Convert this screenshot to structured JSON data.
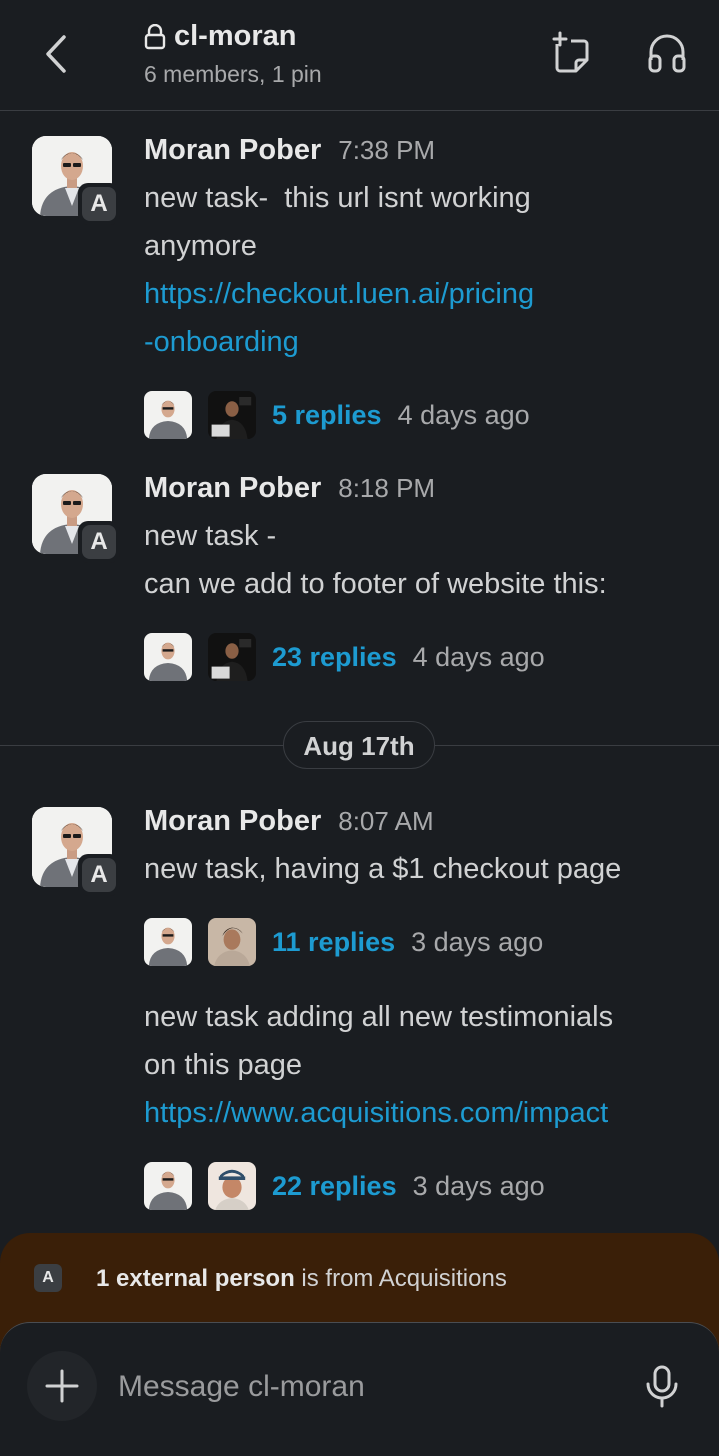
{
  "header": {
    "channel_name": "cl-moran",
    "subtitle": "6 members, 1 pin"
  },
  "messages": [
    {
      "author": "Moran Pober",
      "time": "7:38 PM",
      "badge": "A",
      "lines": [
        "new task-  this url isnt working",
        "anymore"
      ],
      "link_lines": [
        "https://checkout.luen.ai/pricing",
        "-onboarding"
      ],
      "thread": {
        "replies": "5 replies",
        "ago": "4 days ago"
      }
    },
    {
      "author": "Moran Pober",
      "time": "8:18 PM",
      "badge": "A",
      "lines": [
        "new task -",
        "can we add to footer of website this:"
      ],
      "thread": {
        "replies": "23 replies",
        "ago": "4 days ago"
      }
    },
    {
      "author": "Moran Pober",
      "time": "8:07 AM",
      "badge": "A",
      "lines": [
        "new task, having a $1 checkout page"
      ],
      "thread": {
        "replies": "11 replies",
        "ago": "3 days ago"
      }
    },
    {
      "lines": [
        "new task adding all new testimonials",
        "on this page"
      ],
      "link_lines": [
        "https://www.acquisitions.com/impact"
      ],
      "thread": {
        "replies": "22 replies",
        "ago": "3 days ago"
      }
    }
  ],
  "date_divider": "Aug 17th",
  "external_banner": {
    "badge": "A",
    "bold": "1 external person",
    "rest": " is from Acquisitions"
  },
  "composer": {
    "placeholder": "Message cl-moran"
  },
  "colors": {
    "background": "#1a1d21",
    "link": "#1d9bd1",
    "banner": "#3a1f08"
  },
  "icons": {
    "back": "chevron-left-icon",
    "lock": "lock-icon",
    "canvas": "new-canvas-icon",
    "huddle": "headphones-icon",
    "plus": "plus-icon",
    "mic": "microphone-icon"
  }
}
